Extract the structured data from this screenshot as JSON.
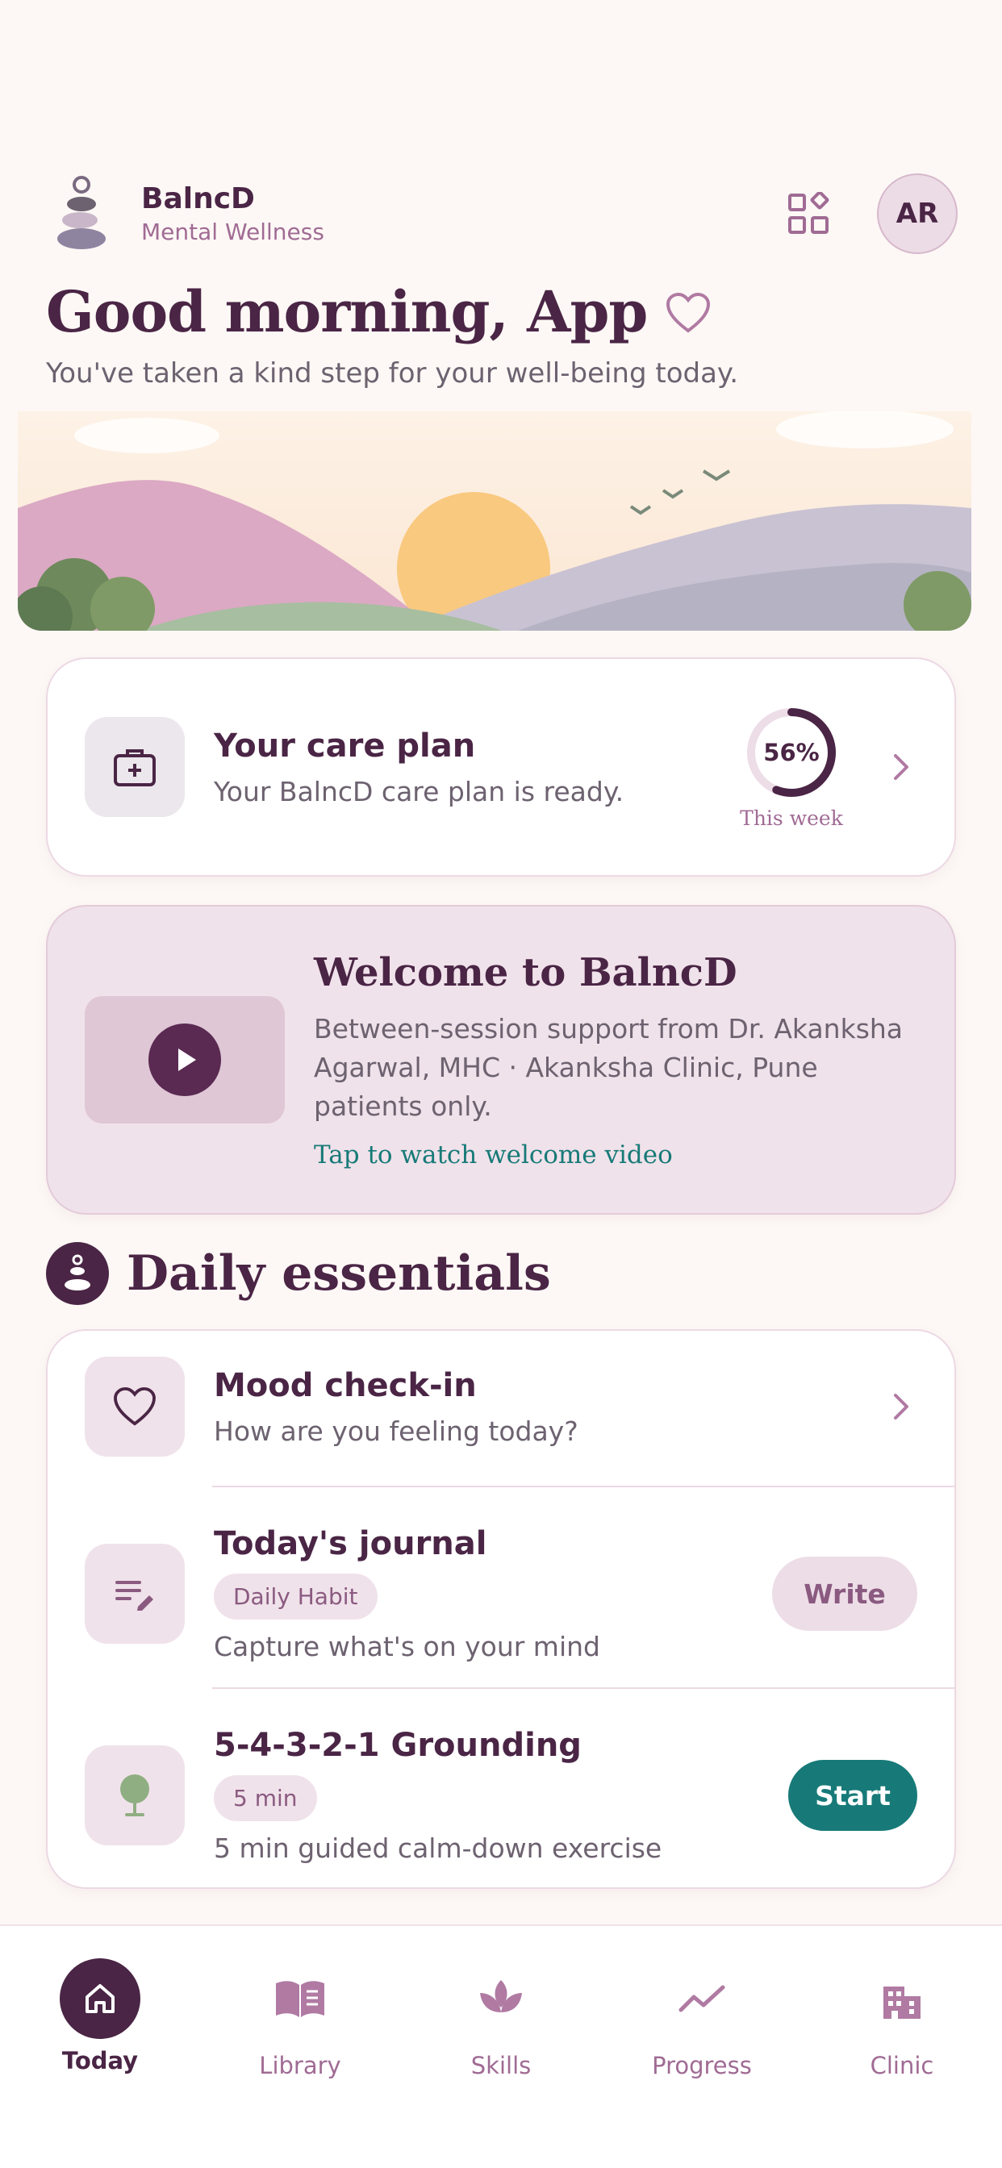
{
  "app": {
    "name": "BalncD",
    "tagline": "Mental Wellness",
    "avatar_initials": "AR"
  },
  "greeting": {
    "title": "Good morning, App",
    "subtitle": "You've taken a kind step for your well-being today."
  },
  "care_plan": {
    "title": "Your care plan",
    "description": "Your BalncD care plan is ready.",
    "progress_percent": 56,
    "progress_label": "56%",
    "progress_caption": "This week"
  },
  "welcome": {
    "title": "Welcome to BalncD",
    "description": "Between-session support from Dr. Akanksha Agarwal, MHC · Akanksha Clinic, Pune patients only.",
    "link": "Tap to watch welcome video"
  },
  "daily_essentials": {
    "heading": "Daily essentials",
    "items": [
      {
        "title": "Mood check-in",
        "description": "How are you feeling today?",
        "icon": "heart-icon"
      },
      {
        "title": "Today's journal",
        "tag": "Daily Habit",
        "description": "Capture what's on your mind",
        "action": "Write",
        "icon": "journal-icon"
      },
      {
        "title": "5-4-3-2-1 Grounding",
        "tag": "5 min",
        "description": "5 min guided calm-down exercise",
        "action": "Start",
        "icon": "tree-icon"
      }
    ]
  },
  "nav": {
    "items": [
      {
        "label": "Today",
        "icon": "home-icon",
        "active": true
      },
      {
        "label": "Library",
        "icon": "book-icon"
      },
      {
        "label": "Skills",
        "icon": "lotus-icon"
      },
      {
        "label": "Progress",
        "icon": "trend-icon"
      },
      {
        "label": "Clinic",
        "icon": "building-icon"
      }
    ]
  },
  "colors": {
    "primary": "#4a2545",
    "accent": "#177a78",
    "muted": "#a06b94",
    "background": "#fdf8f5"
  }
}
